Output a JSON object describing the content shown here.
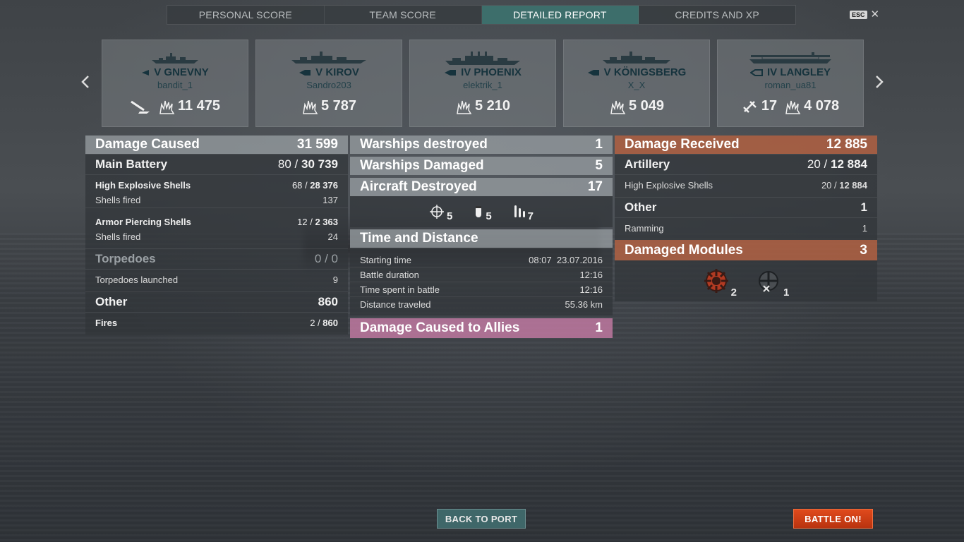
{
  "tabs": [
    {
      "label": "PERSONAL SCORE",
      "active": false
    },
    {
      "label": "TEAM SCORE",
      "active": false
    },
    {
      "label": "DETAILED REPORT",
      "active": true
    },
    {
      "label": "CREDITS AND XP",
      "active": false
    }
  ],
  "esc": {
    "key": "ESC"
  },
  "ships": [
    {
      "tier_name": "V GNEVNY",
      "player": "bandit_1",
      "class_icon": "destroyer-icon",
      "stats": [
        {
          "icon": "torpedo-hit-icon",
          "value": ""
        },
        {
          "icon": "damage-burst-icon",
          "value": "11 475"
        }
      ]
    },
    {
      "tier_name": "V KIROV",
      "player": "Sandro203",
      "class_icon": "cruiser-icon",
      "stats": [
        {
          "icon": "damage-burst-icon",
          "value": "5 787"
        }
      ]
    },
    {
      "tier_name": "IV PHOENIX",
      "player": "elektrik_1",
      "class_icon": "cruiser-icon",
      "stats": [
        {
          "icon": "damage-burst-icon",
          "value": "5 210"
        }
      ]
    },
    {
      "tier_name": "V KÖNIGSBERG",
      "player": "X_X",
      "class_icon": "cruiser-icon",
      "stats": [
        {
          "icon": "damage-burst-icon",
          "value": "5 049"
        }
      ]
    },
    {
      "tier_name": "IV LANGLEY",
      "player": "roman_ua81",
      "class_icon": "carrier-icon",
      "stats": [
        {
          "icon": "planes-shot-icon",
          "value": "17"
        },
        {
          "icon": "damage-burst-icon",
          "value": "4 078"
        }
      ]
    }
  ],
  "left": {
    "damage_caused": {
      "label": "Damage Caused",
      "value": "31 599"
    },
    "main_battery": {
      "label": "Main Battery",
      "part": "80 / ",
      "total": "30 739"
    },
    "he_shells": {
      "label": "High Explosive Shells",
      "part": "68 / ",
      "total": "28 376"
    },
    "he_fired": {
      "label": "Shells fired",
      "value": "137"
    },
    "ap_shells": {
      "label": "Armor Piercing Shells",
      "part": "12 / ",
      "total": "2 363"
    },
    "ap_fired": {
      "label": "Shells fired",
      "value": "24"
    },
    "torpedoes": {
      "label": "Torpedoes",
      "value": "0 / 0"
    },
    "torpedoes_launched": {
      "label": "Torpedoes launched",
      "value": "9"
    },
    "other": {
      "label": "Other",
      "value": "860"
    },
    "fires": {
      "label": "Fires",
      "part": "2 / ",
      "total": "860"
    }
  },
  "middle": {
    "warships_destroyed": {
      "label": "Warships destroyed",
      "value": "1"
    },
    "warships_damaged": {
      "label": "Warships Damaged",
      "value": "5"
    },
    "aircraft_destroyed": {
      "label": "Aircraft Destroyed",
      "value": "17"
    },
    "aircraft_icons": [
      {
        "icon": "crosshair-icon",
        "value": "5"
      },
      {
        "icon": "bomb-icon",
        "value": "5"
      },
      {
        "icon": "torpedo-bomber-icon",
        "value": "7"
      }
    ],
    "time_distance": {
      "label": "Time and Distance"
    },
    "starting_time": {
      "label": "Starting time",
      "value": "08:07  23.07.2016"
    },
    "battle_duration": {
      "label": "Battle duration",
      "value": "12:16"
    },
    "time_in_battle": {
      "label": "Time spent in battle",
      "value": "12:16"
    },
    "distance": {
      "label": "Distance traveled",
      "value": "55.36 km"
    },
    "damage_allies": {
      "label": "Damage Caused to Allies",
      "value": "1"
    }
  },
  "right": {
    "damage_received": {
      "label": "Damage Received",
      "value": "12 885"
    },
    "artillery": {
      "label": "Artillery",
      "part": "20 / ",
      "total": "12 884"
    },
    "he_shells": {
      "label": "High Explosive Shells",
      "part": "20 / ",
      "total": "12 884"
    },
    "other": {
      "label": "Other",
      "value": "1"
    },
    "ramming": {
      "label": "Ramming",
      "value": "1"
    },
    "damaged_modules": {
      "label": "Damaged Modules",
      "value": "3"
    },
    "module_icons": [
      {
        "icon": "steering-gear-icon",
        "value": "2"
      },
      {
        "icon": "propulsion-icon",
        "value": "1"
      }
    ]
  },
  "buttons": {
    "back": "BACK TO PORT",
    "battle": "BATTLE ON!"
  },
  "colors": {
    "tab_active": "#3d6e6b",
    "header_grey": "#969ca0",
    "header_orange": "#b06042",
    "header_pink": "#be78a0",
    "battle_button": "#d0401a"
  }
}
